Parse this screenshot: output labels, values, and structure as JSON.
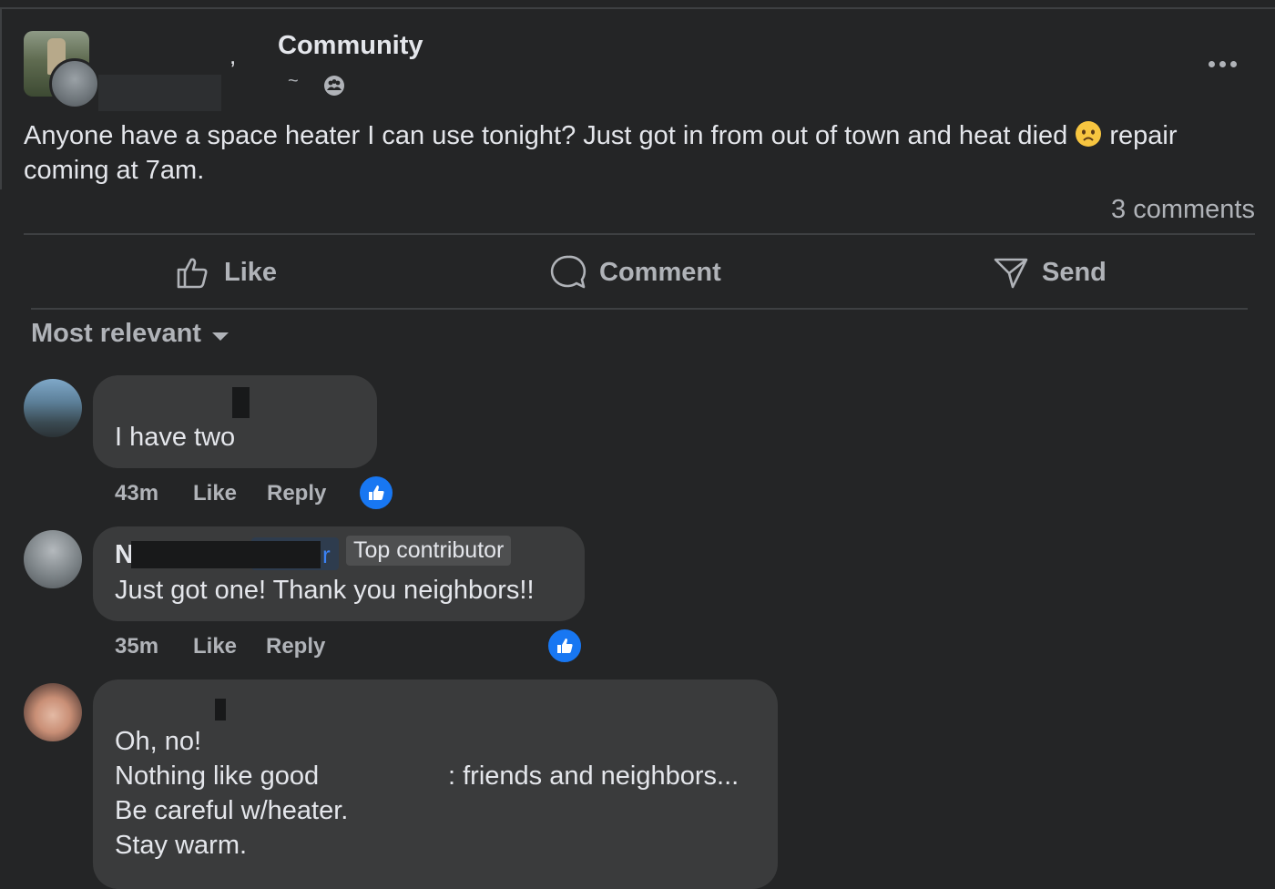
{
  "post": {
    "group_name": "Community",
    "comma": ",",
    "meta_dash": "~",
    "text_before_emoji": "Anyone have a space heater I can use tonight? Just got in from out of town and heat died ",
    "text_after_emoji": " repair coming at 7am.",
    "comments_count": "3 comments"
  },
  "actions": {
    "like": "Like",
    "comment": "Comment",
    "send": "Send"
  },
  "sort": {
    "label": "Most relevant"
  },
  "comments": [
    {
      "text": "I have two",
      "time": "43m",
      "like": "Like",
      "reply": "Reply"
    },
    {
      "name_initial": "N",
      "name_tail": "r",
      "badge": "Top contributor",
      "text": "Just got one! Thank you neighbors!!",
      "time": "35m",
      "like": "Like",
      "reply": "Reply"
    },
    {
      "line1": "Oh, no!",
      "line2a": "Nothing like good",
      "line2b": ": friends and neighbors...",
      "line3": "Be careful w/heater.",
      "line4": "Stay warm."
    }
  ],
  "colors": {
    "background": "#242526",
    "bubble": "#3a3b3c",
    "accent_blue": "#1877f2",
    "secondary_text": "#b0b3b8"
  }
}
